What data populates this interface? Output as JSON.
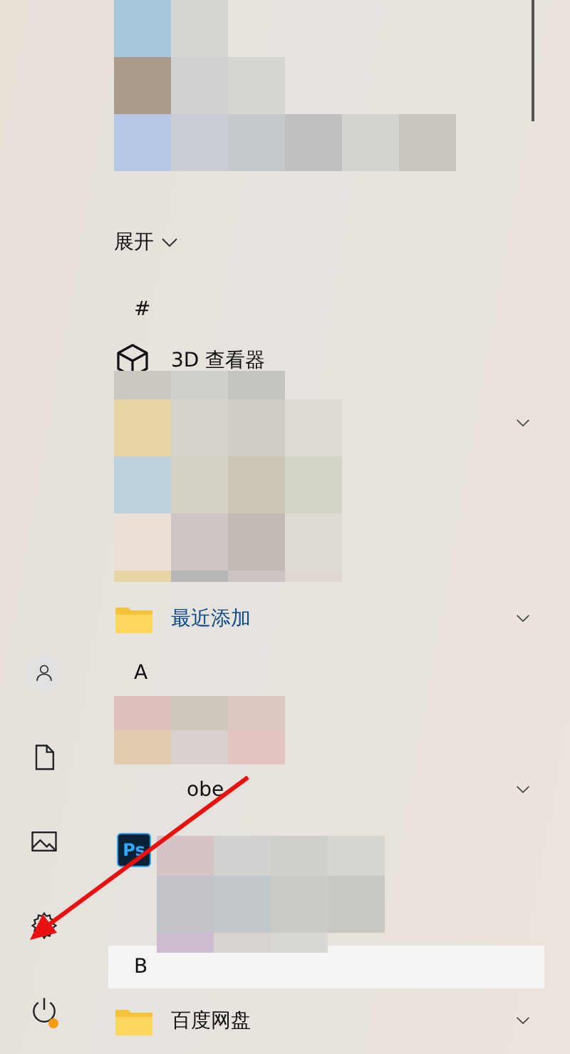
{
  "rail": [
    {
      "kind": "user"
    },
    {
      "kind": "documents"
    },
    {
      "kind": "pictures"
    },
    {
      "kind": "settings"
    },
    {
      "kind": "power",
      "notification": true
    }
  ],
  "list": [
    {
      "kind": "hidden"
    },
    {
      "kind": "hidden"
    },
    {
      "kind": "hidden"
    },
    {
      "kind": "expand",
      "label": "展开"
    },
    {
      "kind": "header",
      "label": "#",
      "selected": false
    },
    {
      "kind": "app",
      "label": "3D 查看器"
    },
    {
      "kind": "hidden",
      "expanded": false
    },
    {
      "kind": "hidden"
    },
    {
      "kind": "hidden"
    },
    {
      "kind": "folder",
      "label": "最近添加",
      "accent": true,
      "expanded": false
    },
    {
      "kind": "header",
      "label": "A",
      "selected": false
    },
    {
      "kind": "hidden"
    },
    {
      "kind": "group",
      "label": "obe",
      "expanded": false
    },
    {
      "kind": "app",
      "badge": "Ps"
    },
    {
      "kind": "hidden"
    },
    {
      "kind": "header",
      "label": "B",
      "selected": true
    },
    {
      "kind": "folder",
      "label": "百度网盘",
      "accent": false,
      "expanded": false
    }
  ],
  "mosaics": [
    {
      "kind": "mosaic"
    },
    {
      "kind": "mosaic"
    },
    {
      "kind": "mosaic"
    },
    {
      "kind": "mosaic"
    }
  ],
  "annotation": {
    "kind": "arrow"
  }
}
